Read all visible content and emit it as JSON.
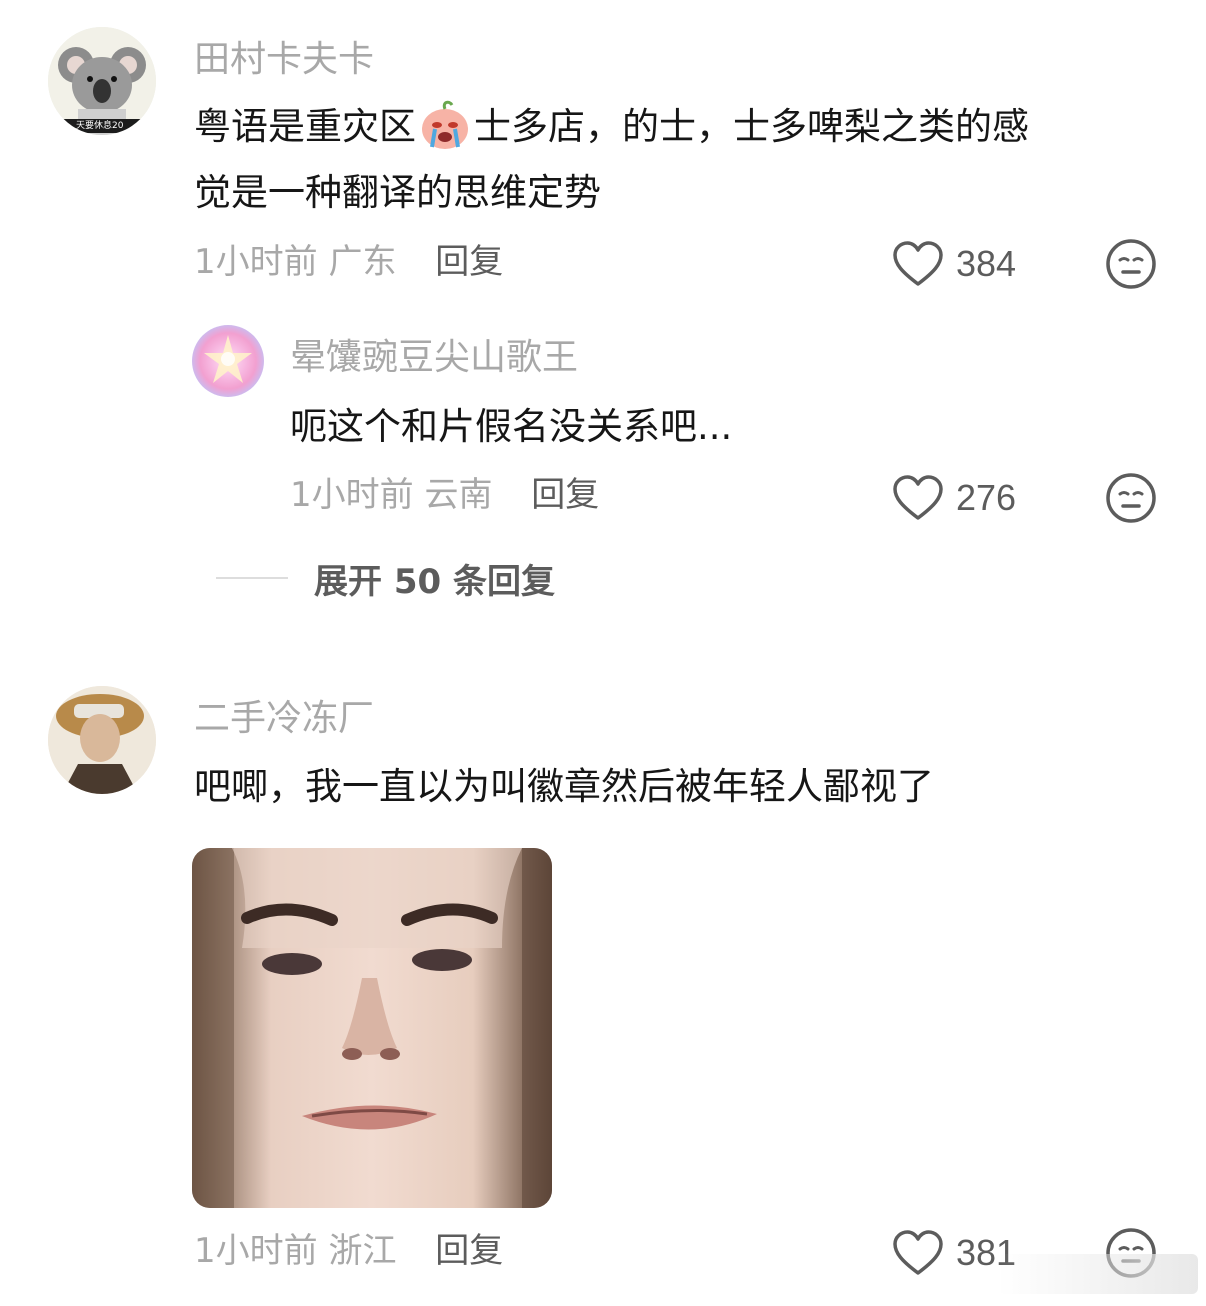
{
  "comments": [
    {
      "username": "田村卡夫卡",
      "text_line1_before": "粤语是重灾区",
      "inline_emoji": "crying-peach-emoji",
      "text_line1_after": "士多店，的士，士多啤梨之类的感",
      "text_line2": "觉是一种翻译的思维定势",
      "time": "1小时前",
      "location": "广东",
      "reply_label": "回复",
      "likes": "384",
      "avatar_badge_text": "天要休息20",
      "replies": [
        {
          "username": "晕馕豌豆尖山歌王",
          "text": "呃这个和片假名没关系吧...",
          "time": "1小时前",
          "location": "云南",
          "reply_label": "回复",
          "likes": "276"
        }
      ],
      "expand_label": "展开 50 条回复"
    },
    {
      "username": "二手冷冻厂",
      "text": "吧唧，我一直以为叫徽章然后被年轻人鄙视了",
      "time": "1小时前",
      "location": "浙江",
      "reply_label": "回复",
      "likes": "381"
    }
  ],
  "colors": {
    "username": "#a8a8a8",
    "body_text": "#161616",
    "action_text": "#5c5c5c",
    "icon_stroke": "#5c5c5c"
  },
  "icons": {
    "like": "heart-outline-icon",
    "dislike": "meh-face-icon"
  }
}
